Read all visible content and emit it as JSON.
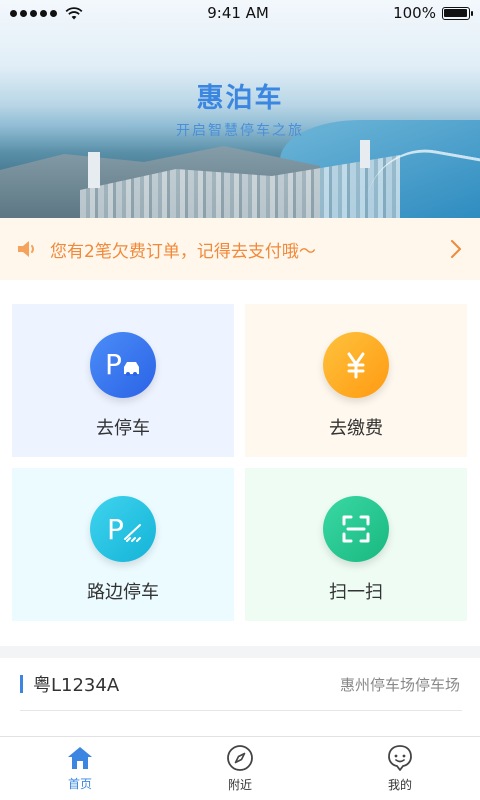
{
  "status_bar": {
    "time": "9:41 AM",
    "battery": "100%"
  },
  "hero": {
    "title": "惠泊车",
    "subtitle": "开启智慧停车之旅"
  },
  "notice": {
    "text": "您有2笔欠费订单，记得去支付哦～",
    "icon": "speaker-icon"
  },
  "actions": [
    {
      "label": "去停车",
      "icon": "parking-car-icon",
      "color": "#3a7df0"
    },
    {
      "label": "去缴费",
      "icon": "yuan-icon",
      "color": "#ffab1f"
    },
    {
      "label": "路边停车",
      "icon": "roadside-parking-icon",
      "color": "#20c0e0"
    },
    {
      "label": "扫一扫",
      "icon": "scan-icon",
      "color": "#22c48e"
    }
  ],
  "record": {
    "plate": "粤L1234A",
    "lot": "惠州停车场停车场"
  },
  "tabs": [
    {
      "label": "首页",
      "icon": "home-icon",
      "active": true
    },
    {
      "label": "附近",
      "icon": "compass-icon",
      "active": false
    },
    {
      "label": "我的",
      "icon": "profile-icon",
      "active": false
    }
  ],
  "colors": {
    "accent": "#3a86e0",
    "notice_text": "#f08a3a",
    "notice_bg": "#fff6ec"
  }
}
